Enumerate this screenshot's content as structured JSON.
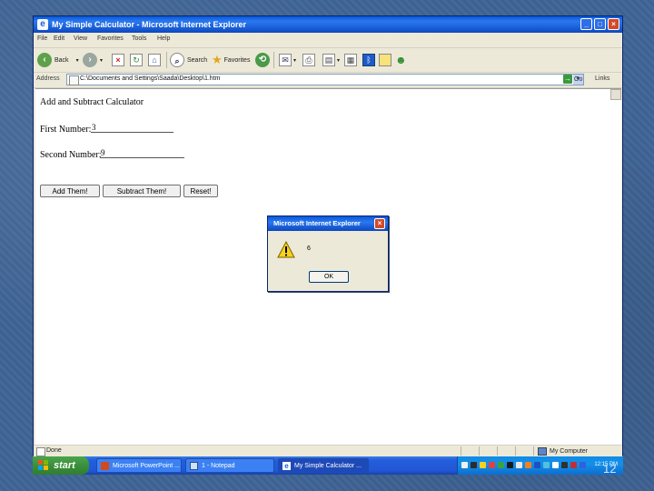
{
  "window": {
    "title": "My Simple Calculator - Microsoft Internet Explorer",
    "controls": {
      "minimize": "_",
      "maximize": "□",
      "close": "×"
    }
  },
  "menu": [
    "File",
    "Edit",
    "View",
    "Favorites",
    "Tools",
    "Help"
  ],
  "toolbar": {
    "back_label": "Back",
    "search_label": "Search",
    "favorites_label": "Favorites"
  },
  "address": {
    "label": "Address",
    "url": "C:\\Documents and Settings\\Saada\\Desktop\\1.htm",
    "go_label": "Go",
    "links_label": "Links"
  },
  "page": {
    "heading": "Add and Subtract Calculator",
    "first_label": "First Number:",
    "first_value": "3",
    "second_label": "Second Number:",
    "second_value": "9",
    "buttons": {
      "add": "Add Them!",
      "subtract": "Subtract Them!",
      "reset": "Reset!"
    }
  },
  "status": {
    "text": "Done",
    "zone": "My Computer"
  },
  "dialog": {
    "title": "Microsoft Internet Explorer",
    "message": "6",
    "ok_label": "OK"
  },
  "taskbar": {
    "start_label": "start",
    "tasks": [
      "Microsoft PowerPoint ...",
      "1 - Notepad",
      "My Simple Calculator ..."
    ],
    "clock": "12:15 PM"
  },
  "slide": {
    "number": "12"
  },
  "colors": {
    "xp_blue": "#245edb",
    "start_green": "#3c8f3c",
    "close_red": "#d44a26",
    "desktop": "#3f6496"
  }
}
